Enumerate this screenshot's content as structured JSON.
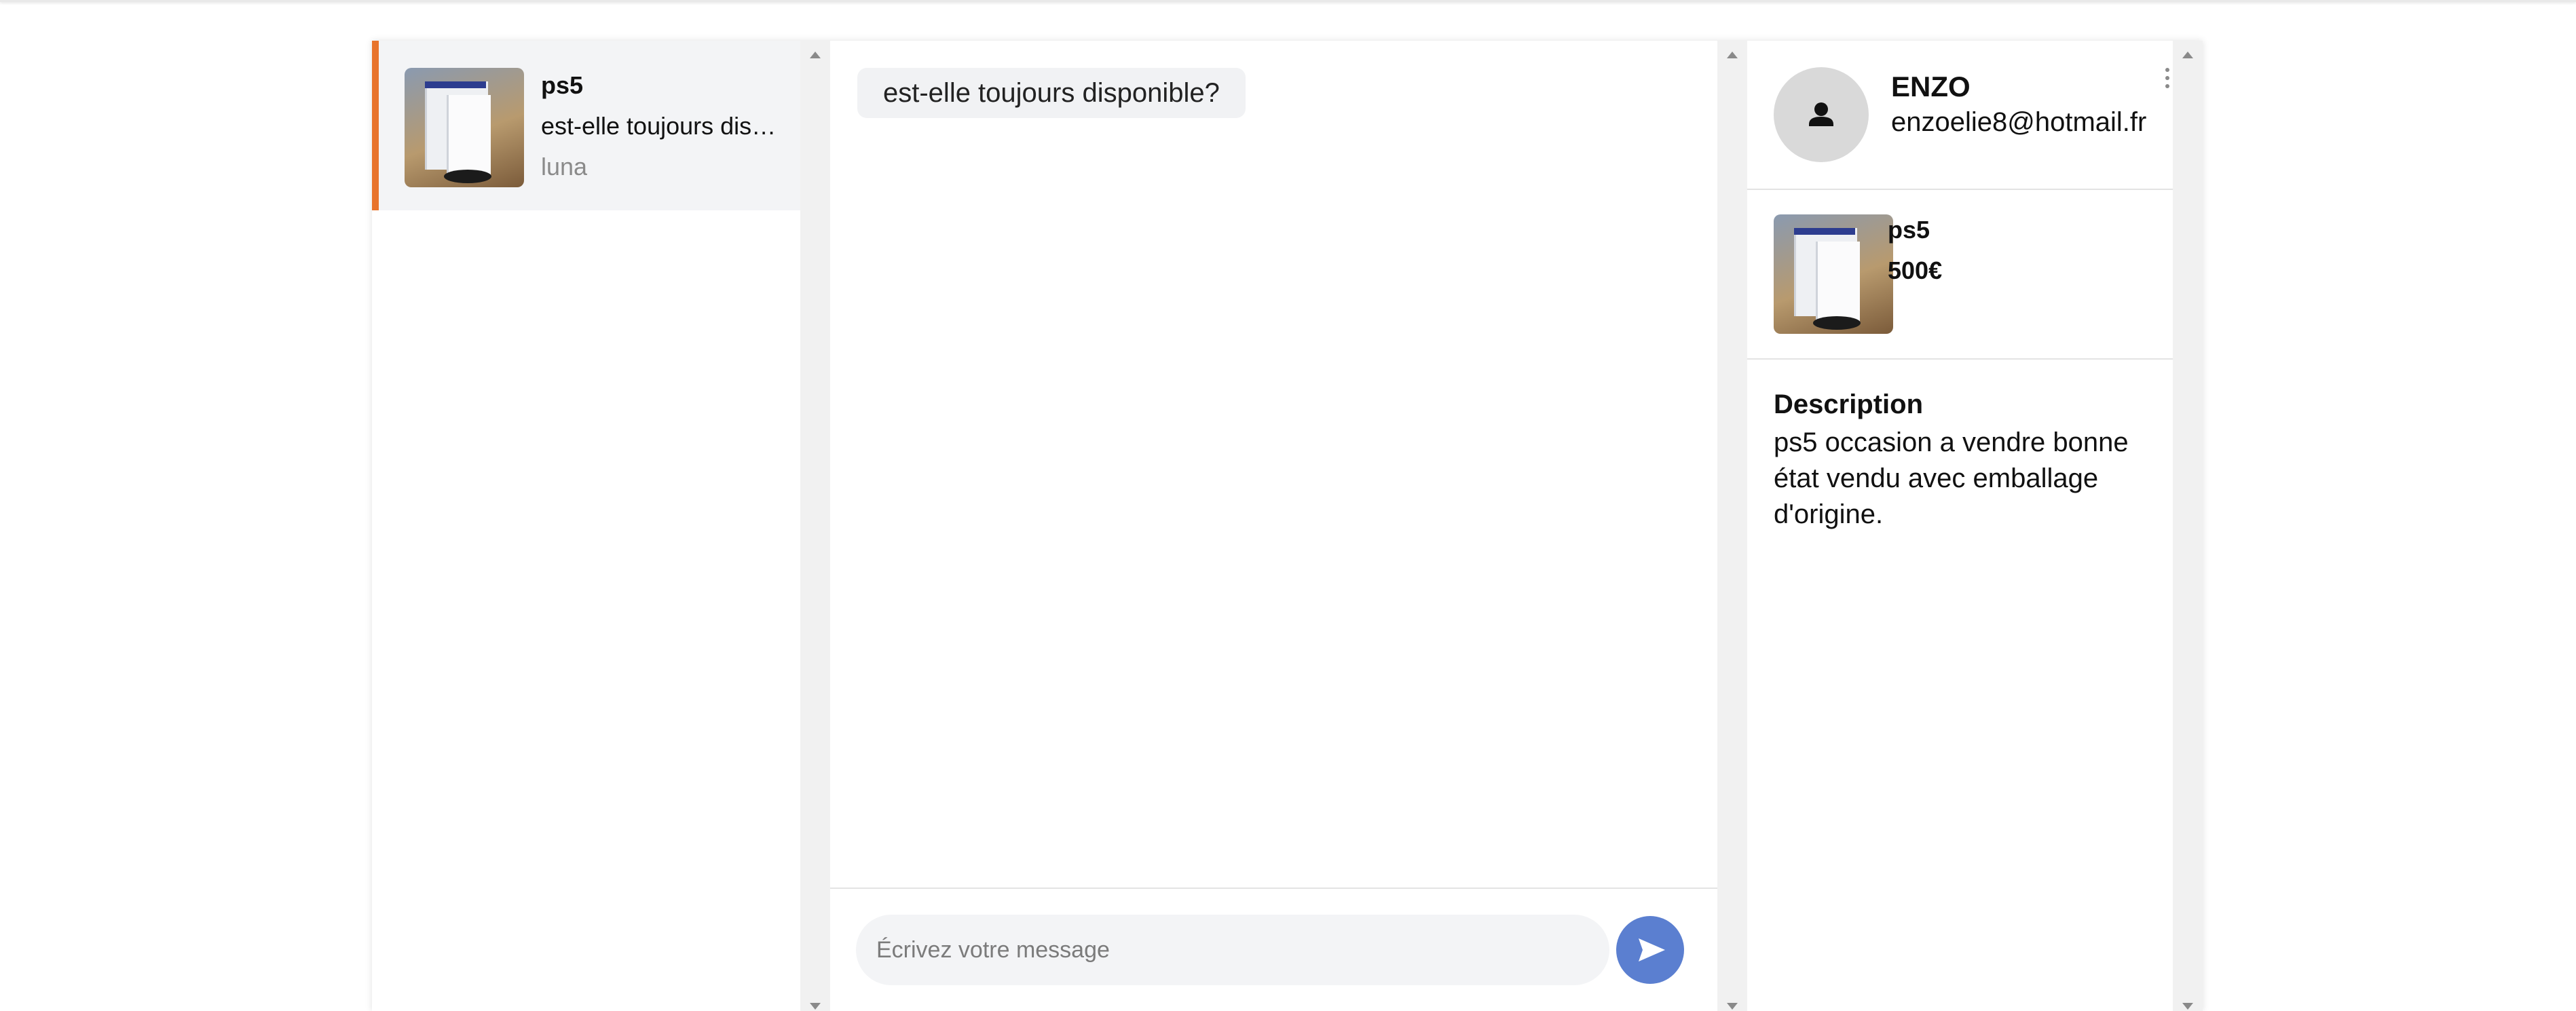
{
  "conversations": [
    {
      "title": "ps5",
      "last_message": "est-elle toujours disponible?",
      "user": "luna",
      "active": true,
      "accent_color": "#e8742c"
    }
  ],
  "chat": {
    "messages": [
      {
        "text": "est-elle toujours disponible?"
      }
    ],
    "composer": {
      "placeholder": "Écrivez votre message",
      "value": "",
      "send_icon": "send-icon",
      "send_color": "#5b7fd0"
    }
  },
  "seller": {
    "name": "ENZO",
    "email": "enzoelie8@hotmail.fr",
    "avatar_icon": "user-icon",
    "menu_icon": "more-vertical-icon"
  },
  "product": {
    "title": "ps5",
    "price": "500€",
    "description_label": "Description",
    "description": "ps5 occasion a vendre bonne état vendu avec emballage d'origine."
  }
}
